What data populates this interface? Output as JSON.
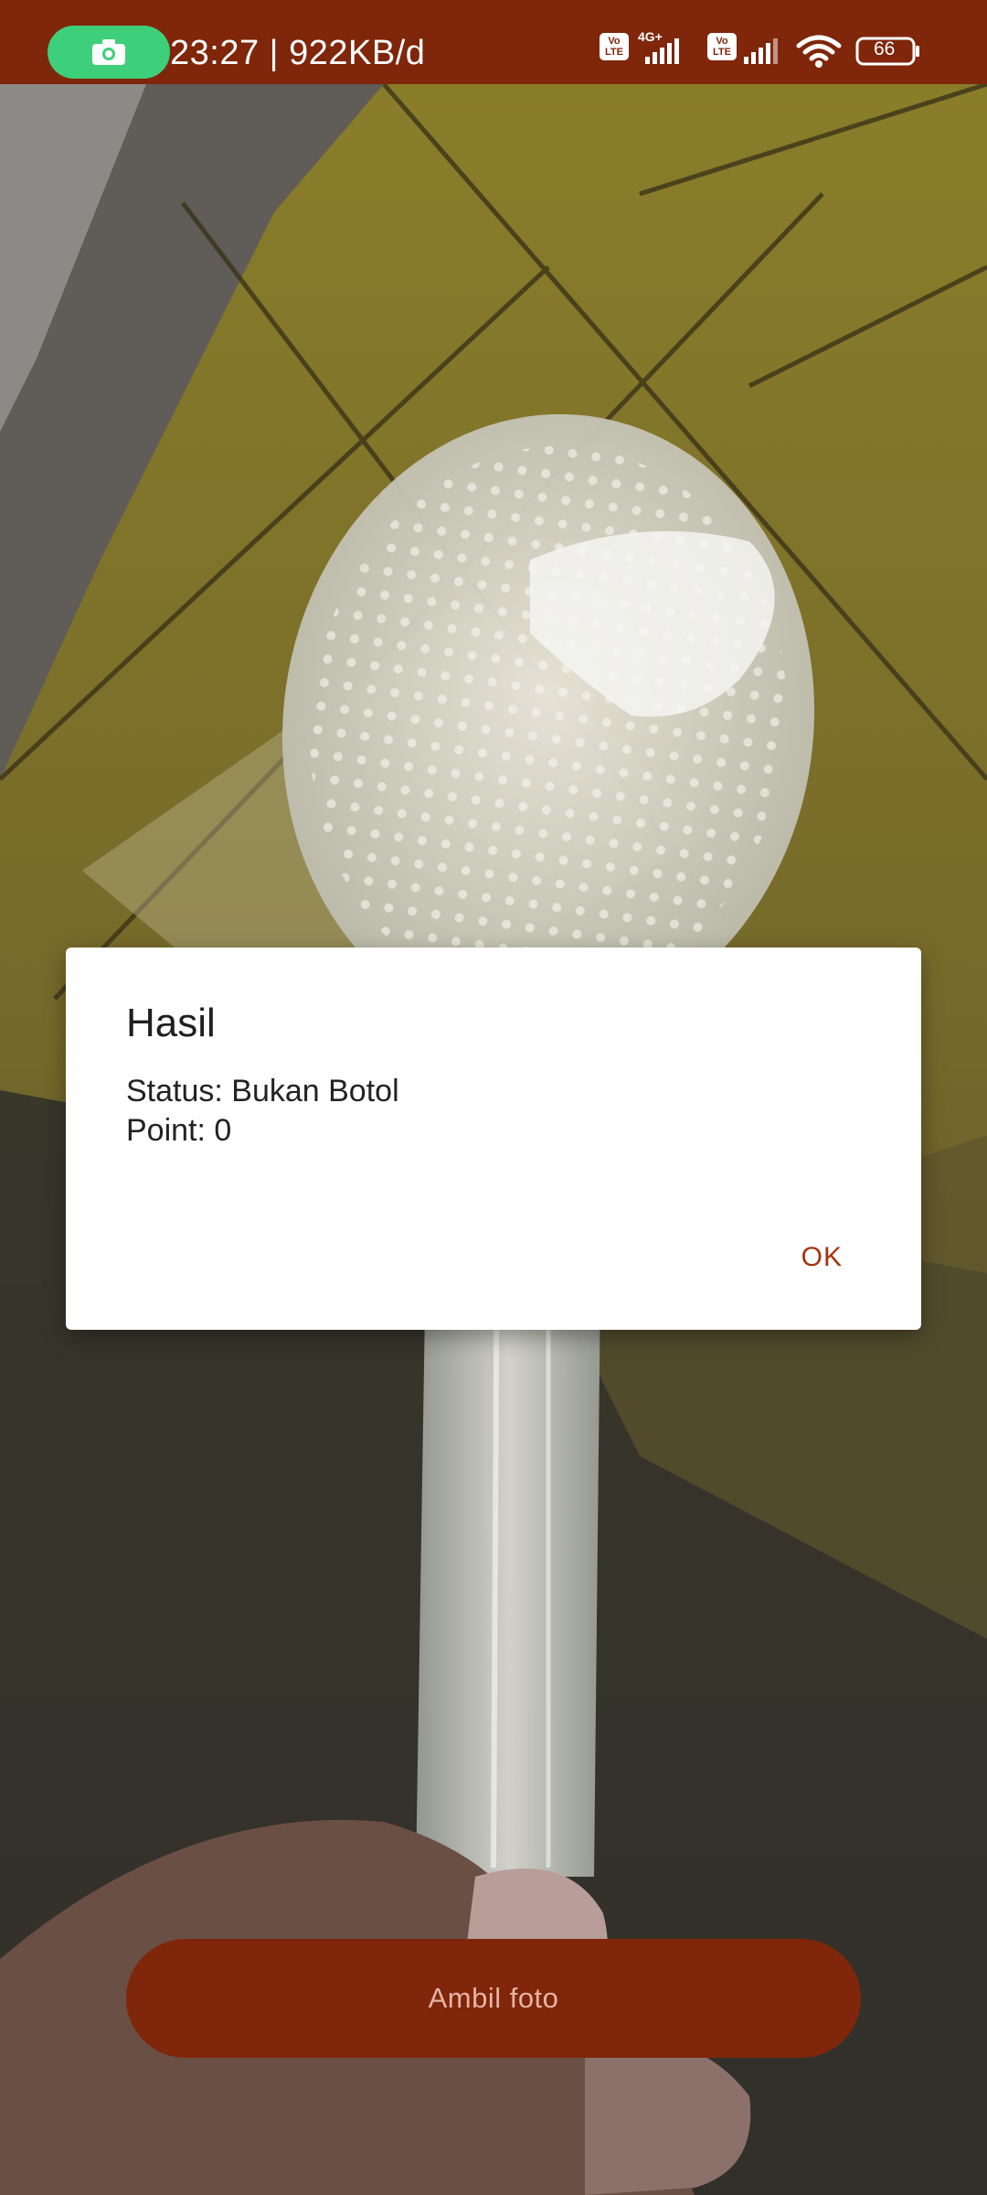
{
  "status_bar": {
    "time_and_speed": "23:27 | 922KB/d",
    "network_label": "4G+",
    "volte_label_1": "Vo LTE",
    "volte_label_2": "Vo LTE",
    "battery": "66",
    "recording_icon": "camera-icon",
    "colors": {
      "background": "#7f260b",
      "recording_pill": "#3ecf7b"
    }
  },
  "dialog": {
    "title": "Hasil",
    "status_line": "Status: Bukan Botol",
    "point_line": "Point: 0",
    "ok_label": "OK"
  },
  "capture": {
    "label": "Ambil foto",
    "color": "#7f260b"
  }
}
